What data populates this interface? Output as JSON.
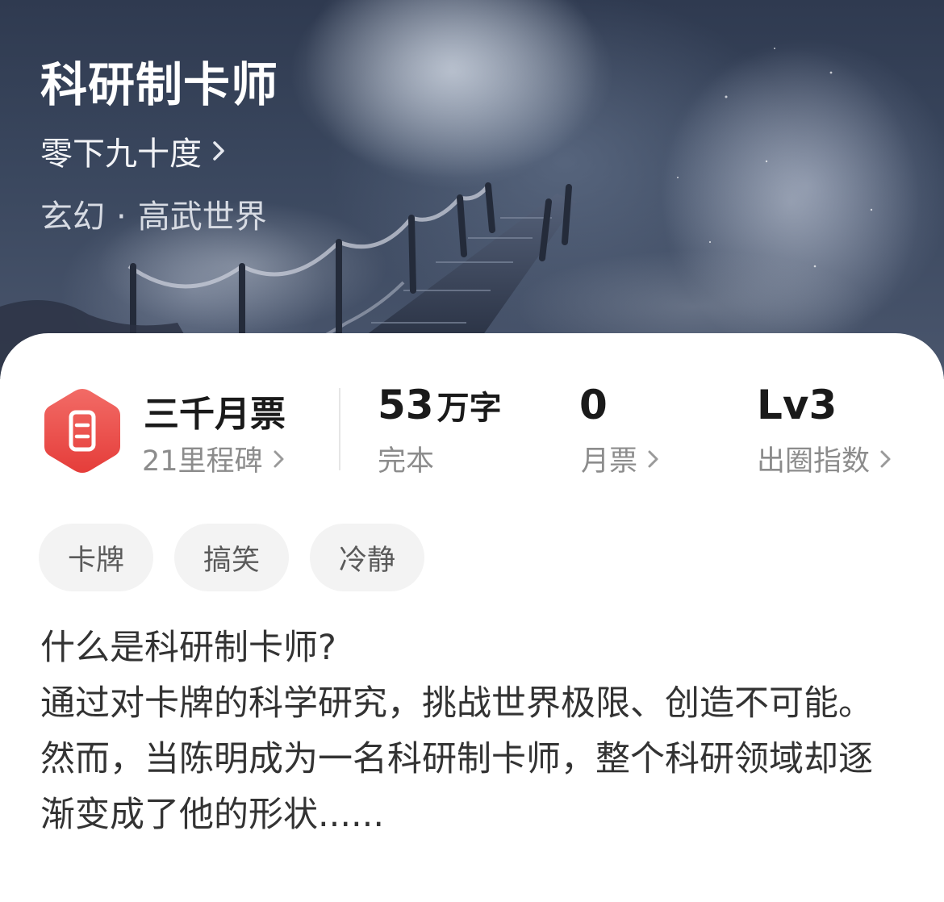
{
  "book": {
    "title": "科研制卡师",
    "author": "零下九十度",
    "genre": "玄幻",
    "subgenre": "高武世界",
    "separator": "·"
  },
  "stats": {
    "rank": {
      "title": "三千月票",
      "subtitle": "21里程碑"
    },
    "words": {
      "value": "53",
      "unit": "万字",
      "label": "完本"
    },
    "monthly_votes": {
      "value": "0",
      "label": "月票"
    },
    "popularity": {
      "value": "Lv3",
      "label": "出圈指数"
    }
  },
  "tags": [
    "卡牌",
    "搞笑",
    "冷静"
  ],
  "synopsis": {
    "line1": "什么是科研制卡师?",
    "line2": "通过对卡牌的科学研究，挑战世界极限、创造不可能。",
    "line3": "然而，当陈明成为一名科研制卡师，整个科研领域却逐渐变成了他的形状......"
  },
  "colors": {
    "badge_red": "#ef5350",
    "badge_red_dark": "#e53935",
    "text_primary": "#1a1a1a",
    "text_secondary": "#8c8c8c",
    "tag_bg": "#f3f3f3"
  },
  "icons": {
    "badge": "ticket-hexagon-icon",
    "chevron": "chevron-right-icon"
  }
}
